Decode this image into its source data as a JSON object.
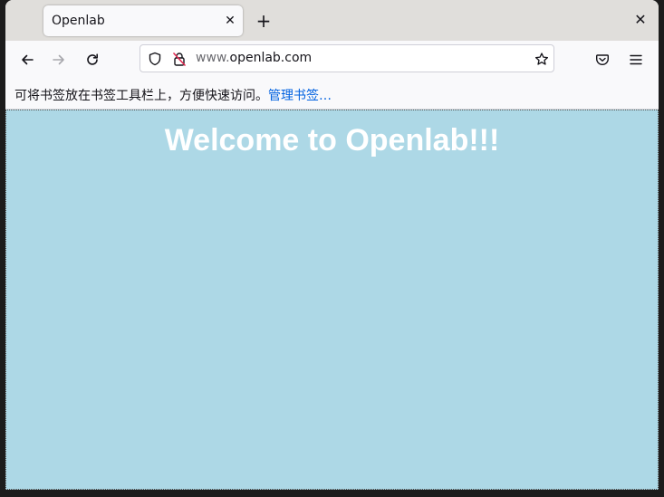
{
  "tab": {
    "title": "Openlab",
    "close_glyph": "✕"
  },
  "newtab": {
    "glyph": "+"
  },
  "window": {
    "close_glyph": "✕"
  },
  "navbar": {
    "back_icon": "arrow-left-icon",
    "forward_icon": "arrow-right-icon",
    "reload_icon": "reload-icon",
    "url_prefix": "www.",
    "url_domain": "openlab.com",
    "shield_icon": "shield-icon",
    "lock_icon": "insecure-lock-icon",
    "star_icon": "star-icon",
    "pocket_icon": "pocket-icon",
    "menu_icon": "hamburger-menu-icon"
  },
  "bookmarks": {
    "hint": "可将书签放在书签工具栏上，方便快速访问。",
    "manage_link": "管理书签…"
  },
  "page": {
    "heading": "Welcome to Openlab!!!",
    "background_color": "#add8e6",
    "heading_color": "#ffffff"
  }
}
